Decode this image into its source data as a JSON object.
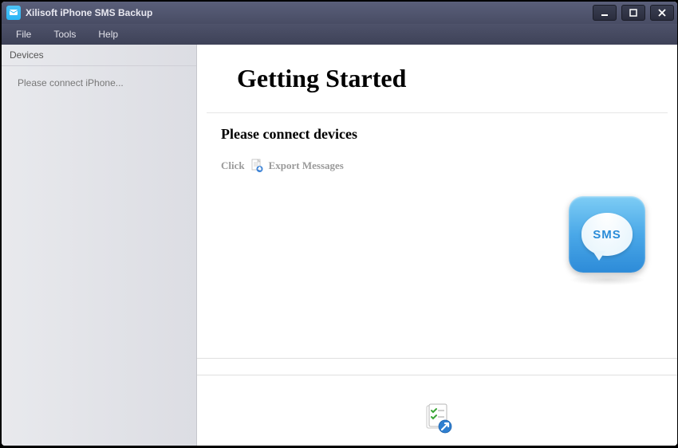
{
  "titlebar": {
    "title": "Xilisoft iPhone SMS Backup"
  },
  "menu": {
    "file": "File",
    "tools": "Tools",
    "help": "Help"
  },
  "sidebar": {
    "header": "Devices",
    "message": "Please connect iPhone..."
  },
  "main": {
    "heading": "Getting Started",
    "subheading": "Please connect devices",
    "click_label": "Click",
    "export_label": "Export Messages",
    "sms_badge_text": "SMS"
  }
}
